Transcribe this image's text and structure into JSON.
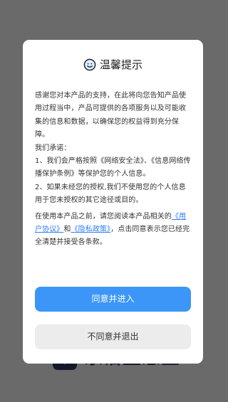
{
  "background_app": {
    "logo_text": "家谱生态宝"
  },
  "dialog": {
    "title": "温馨提示",
    "intro": "感谢您对本产品的支持，在此将向您告知产品使用过程当中，产品可提供的各项服务以及可能收集的信息和数据，以确保您的权益得到充分保障。",
    "promise_heading": "我们承诺：",
    "item1": "1、我们会严格按照《网络安全法》、《信息网络传播保护条例》等保护您的个人信息。",
    "item2": "2、如果未经您的授权,我们不使用您的个人信息用于您未授权的其它途径或目的。",
    "closing_prefix": "在使用本产品之前，请您阅读本产品相关的",
    "user_agreement_link": "《用户协议》",
    "and_text": "和",
    "privacy_policy_link": "《隐私政策》",
    "closing_suffix": "，点击同意表示您已经完全清楚并接受各条款。",
    "agree_button": "同意并进入",
    "disagree_button": "不同意并退出"
  },
  "colors": {
    "accent": "#3b96f7",
    "link": "#2f7ef5",
    "overlay": "#6a6a6a"
  }
}
